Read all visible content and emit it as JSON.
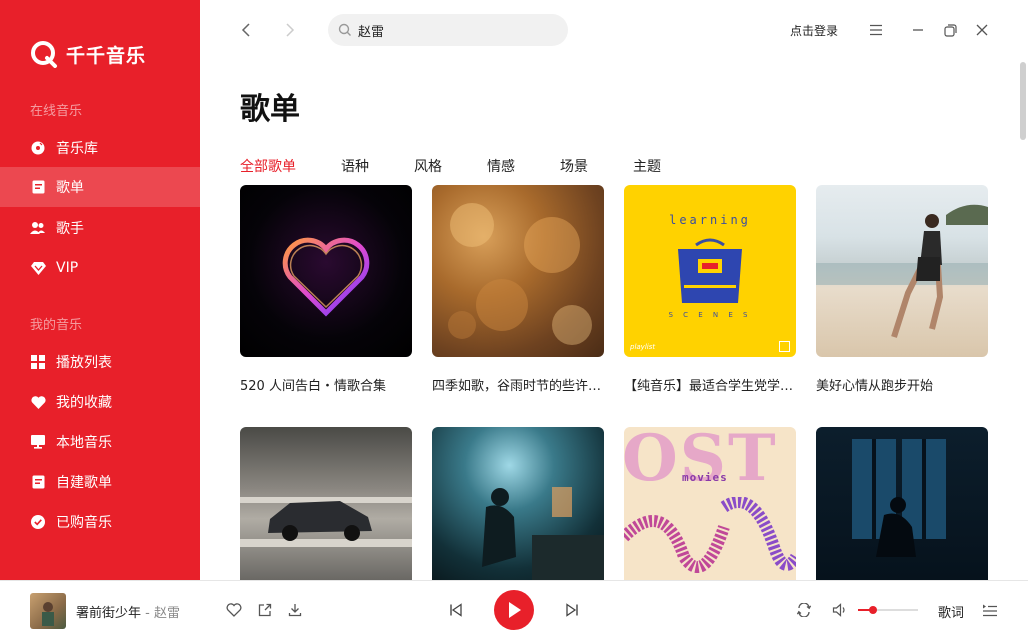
{
  "app": {
    "name": "千千音乐",
    "brand_color": "#e8202a"
  },
  "sidebar": {
    "online_label": "在线音乐",
    "online_items": [
      {
        "label": "音乐库",
        "icon": "disc-icon"
      },
      {
        "label": "歌单",
        "icon": "playlist-icon",
        "active": true
      },
      {
        "label": "歌手",
        "icon": "singer-icon"
      },
      {
        "label": "VIP",
        "icon": "vip-diamond-icon"
      }
    ],
    "mine_label": "我的音乐",
    "mine_items": [
      {
        "label": "播放列表",
        "icon": "grid-icon"
      },
      {
        "label": "我的收藏",
        "icon": "heart-icon"
      },
      {
        "label": "本地音乐",
        "icon": "monitor-icon"
      },
      {
        "label": "自建歌单",
        "icon": "list-doc-icon"
      },
      {
        "label": "已购音乐",
        "icon": "check-circle-icon"
      }
    ]
  },
  "topbar": {
    "search_value": "赵雷",
    "login_label": "点击登录"
  },
  "main": {
    "title": "歌单",
    "tabs": [
      "全部歌单",
      "语种",
      "风格",
      "情感",
      "场景",
      "主题"
    ],
    "cards": [
      {
        "title": "520 人间告白・情歌合集"
      },
      {
        "title": "四季如歌，谷雨时节的些许温柔"
      },
      {
        "title": "【纯音乐】最适合学生党学习的轻音乐"
      },
      {
        "title": "美好心情从跑步开始"
      },
      {
        "title": ""
      },
      {
        "title": ""
      },
      {
        "title": ""
      },
      {
        "title": ""
      }
    ],
    "cover_texts": {
      "learning": "learning",
      "scenes": "S C E N E S",
      "playlist": "playlist",
      "ost": "OST",
      "movies": "movies"
    }
  },
  "player": {
    "song_title": "署前街少年",
    "separator": " - ",
    "artist": "赵雷",
    "lyric_label": "歌词",
    "volume": 0.25
  }
}
